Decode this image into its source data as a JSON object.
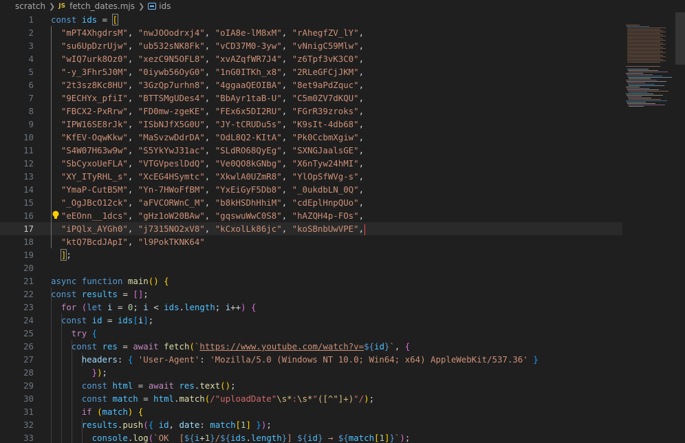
{
  "breadcrumb": {
    "folder": "scratch",
    "file_type": "JS",
    "file": "fetch_dates.mjs",
    "symbol": "ids"
  },
  "editor": {
    "active_line": 17,
    "lines": [
      {
        "n": "1",
        "t": [
          [
            "k",
            "const "
          ],
          [
            "v",
            "ids"
          ],
          [
            "o",
            " = "
          ],
          [
            "b1",
            "["
          ]
        ]
      },
      {
        "n": "2",
        "t": [
          [
            "s",
            "\"mPT4XhgdrsM\""
          ],
          [
            "o",
            ", "
          ],
          [
            "s",
            "\"nwJOOodrxj4\""
          ],
          [
            "o",
            ", "
          ],
          [
            "s",
            "\"oIA8e-lM8xM\""
          ],
          [
            "o",
            ", "
          ],
          [
            "s",
            "\"rAhegfZV_lY\""
          ],
          [
            "o",
            ","
          ]
        ]
      },
      {
        "n": "3",
        "t": [
          [
            "s",
            "\"su6UpDzrUjw\""
          ],
          [
            "o",
            ", "
          ],
          [
            "s",
            "\"ub532sNK8Fk\""
          ],
          [
            "o",
            ", "
          ],
          [
            "s",
            "\"vCD37M0-3yw\""
          ],
          [
            "o",
            ", "
          ],
          [
            "s",
            "\"vNnigC59Mlw\""
          ],
          [
            "o",
            ","
          ]
        ]
      },
      {
        "n": "4",
        "t": [
          [
            "s",
            "\"wIQ7urk8Oz0\""
          ],
          [
            "o",
            ", "
          ],
          [
            "s",
            "\"xezC9N5OFL8\""
          ],
          [
            "o",
            ", "
          ],
          [
            "s",
            "\"xvAZqfWR7J4\""
          ],
          [
            "o",
            ", "
          ],
          [
            "s",
            "\"z6Tpf3vK3C0\""
          ],
          [
            "o",
            ","
          ]
        ]
      },
      {
        "n": "5",
        "t": [
          [
            "s",
            "\"-y_3Fhr5J0M\""
          ],
          [
            "o",
            ", "
          ],
          [
            "s",
            "\"0iywb56OyG0\""
          ],
          [
            "o",
            ", "
          ],
          [
            "s",
            "\"1nG0ITKh_x8\""
          ],
          [
            "o",
            ", "
          ],
          [
            "s",
            "\"2RLeGFCjJKM\""
          ],
          [
            "o",
            ","
          ]
        ]
      },
      {
        "n": "6",
        "t": [
          [
            "s",
            "\"2t3sz8Kc8HU\""
          ],
          [
            "o",
            ", "
          ],
          [
            "s",
            "\"3GzQp7urhn8\""
          ],
          [
            "o",
            ", "
          ],
          [
            "s",
            "\"4ggaaQEOIBA\""
          ],
          [
            "o",
            ", "
          ],
          [
            "s",
            "\"8et9aPdZquc\""
          ],
          [
            "o",
            ","
          ]
        ]
      },
      {
        "n": "7",
        "t": [
          [
            "s",
            "\"9ECHYx_pfiI\""
          ],
          [
            "o",
            ", "
          ],
          [
            "s",
            "\"BTTSMgUDes4\""
          ],
          [
            "o",
            ", "
          ],
          [
            "s",
            "\"BbAyr1taB-U\""
          ],
          [
            "o",
            ", "
          ],
          [
            "s",
            "\"C5m0ZV7dKQU\""
          ],
          [
            "o",
            ","
          ]
        ]
      },
      {
        "n": "8",
        "t": [
          [
            "s",
            "\"FBCX2-PxRrw\""
          ],
          [
            "o",
            ", "
          ],
          [
            "s",
            "\"FD0mw-zgeKE\""
          ],
          [
            "o",
            ", "
          ],
          [
            "s",
            "\"FEx6x5DI2RU\""
          ],
          [
            "o",
            ", "
          ],
          [
            "s",
            "\"FGrR39zroks\""
          ],
          [
            "o",
            ","
          ]
        ]
      },
      {
        "n": "9",
        "t": [
          [
            "s",
            "\"IPW16SE8rJk\""
          ],
          [
            "o",
            ", "
          ],
          [
            "s",
            "\"ISbNJfX5G0U\""
          ],
          [
            "o",
            ", "
          ],
          [
            "s",
            "\"JY-tCRUDu5s\""
          ],
          [
            "o",
            ", "
          ],
          [
            "s",
            "\"K9sIt-4db68\""
          ],
          [
            "o",
            ","
          ]
        ]
      },
      {
        "n": "10",
        "t": [
          [
            "s",
            "\"KfEV-OqwKkw\""
          ],
          [
            "o",
            ", "
          ],
          [
            "s",
            "\"MaSvzwDdrDA\""
          ],
          [
            "o",
            ", "
          ],
          [
            "s",
            "\"OdL8Q2-KItA\""
          ],
          [
            "o",
            ", "
          ],
          [
            "s",
            "\"Pk0CcbmXgiw\""
          ],
          [
            "o",
            ","
          ]
        ]
      },
      {
        "n": "11",
        "t": [
          [
            "s",
            "\"S4W07H63w9w\""
          ],
          [
            "o",
            ", "
          ],
          [
            "s",
            "\"S5YkYwJ31ac\""
          ],
          [
            "o",
            ", "
          ],
          [
            "s",
            "\"SLdRO68QyEg\""
          ],
          [
            "o",
            ", "
          ],
          [
            "s",
            "\"SXNGJaalsGE\""
          ],
          [
            "o",
            ","
          ]
        ]
      },
      {
        "n": "12",
        "t": [
          [
            "s",
            "\"SbCyxoUeFLA\""
          ],
          [
            "o",
            ", "
          ],
          [
            "s",
            "\"VTGVpeslDdQ\""
          ],
          [
            "o",
            ", "
          ],
          [
            "s",
            "\"Ve0QO8kGNbg\""
          ],
          [
            "o",
            ", "
          ],
          [
            "s",
            "\"X6nTyw24hMI\""
          ],
          [
            "o",
            ","
          ]
        ]
      },
      {
        "n": "13",
        "t": [
          [
            "s",
            "\"XY_ITyRHL_s\""
          ],
          [
            "o",
            ", "
          ],
          [
            "s",
            "\"XcEG4HSymtc\""
          ],
          [
            "o",
            ", "
          ],
          [
            "s",
            "\"XkwlA0UZmR8\""
          ],
          [
            "o",
            ", "
          ],
          [
            "s",
            "\"YlOpSfWVg-s\""
          ],
          [
            "o",
            ","
          ]
        ]
      },
      {
        "n": "14",
        "t": [
          [
            "s",
            "\"YmaP-CutB5M\""
          ],
          [
            "o",
            ", "
          ],
          [
            "s",
            "\"Yn-7HWoFfBM\""
          ],
          [
            "o",
            ", "
          ],
          [
            "s",
            "\"YxEiGyF5Db8\""
          ],
          [
            "o",
            ", "
          ],
          [
            "s",
            "\"_0ukdbLN_0Q\""
          ],
          [
            "o",
            ","
          ]
        ]
      },
      {
        "n": "15",
        "t": [
          [
            "s",
            "\"_OgJBcO12ck\""
          ],
          [
            "o",
            ", "
          ],
          [
            "s",
            "\"aFVCORWnC_M\""
          ],
          [
            "o",
            ", "
          ],
          [
            "s",
            "\"b8kHSDhHhiM\""
          ],
          [
            "o",
            ", "
          ],
          [
            "s",
            "\"cdEplHnpQUo\""
          ],
          [
            "o",
            ","
          ]
        ]
      },
      {
        "n": "16",
        "t": [
          [
            "s",
            "\"eEOnn__1dcs\""
          ],
          [
            "o",
            ", "
          ],
          [
            "s",
            "\"gHz1oW20BAw\""
          ],
          [
            "o",
            ", "
          ],
          [
            "s",
            "\"gqswuWwC0S8\""
          ],
          [
            "o",
            ", "
          ],
          [
            "s",
            "\"hAZQH4p-FOs\""
          ],
          [
            "o",
            ","
          ]
        ]
      },
      {
        "n": "17",
        "t": [
          [
            "s",
            "\"iPQlx_AYGh0\""
          ],
          [
            "o",
            ", "
          ],
          [
            "s",
            "\"j7315NO2xV8\""
          ],
          [
            "o",
            ", "
          ],
          [
            "s",
            "\"kCxolLk86jc\""
          ],
          [
            "o",
            ", "
          ],
          [
            "s",
            "\"koSBnbUwVPE\""
          ],
          [
            "o",
            ","
          ]
        ]
      },
      {
        "n": "18",
        "t": [
          [
            "s",
            "\"ktQ7BcdJApI\""
          ],
          [
            "o",
            ", "
          ],
          [
            "s",
            "\"l9PokTKNK64\""
          ]
        ]
      },
      {
        "n": "19",
        "t": [
          [
            "b1",
            "]"
          ],
          [
            "o",
            ";"
          ]
        ]
      },
      {
        "n": "20",
        "t": []
      },
      {
        "n": "21",
        "t": [
          [
            "k",
            "async "
          ],
          [
            "k",
            "function "
          ],
          [
            "f",
            "main"
          ],
          [
            "b1",
            "()"
          ],
          [
            "o",
            " "
          ],
          [
            "b1",
            "{"
          ]
        ]
      },
      {
        "n": "22",
        "t": [
          [
            "k",
            "const "
          ],
          [
            "v",
            "results"
          ],
          [
            "o",
            " = "
          ],
          [
            "b2",
            "[]"
          ],
          [
            "o",
            ";"
          ]
        ]
      },
      {
        "n": "23",
        "t": [
          [
            "kc",
            "for "
          ],
          [
            "b2",
            "("
          ],
          [
            "k",
            "let "
          ],
          [
            "p",
            "i"
          ],
          [
            "o",
            " = "
          ],
          [
            "n",
            "0"
          ],
          [
            "o",
            "; "
          ],
          [
            "p",
            "i"
          ],
          [
            "o",
            " < "
          ],
          [
            "v",
            "ids"
          ],
          [
            "o",
            "."
          ],
          [
            "v",
            "length"
          ],
          [
            "o",
            "; "
          ],
          [
            "p",
            "i"
          ],
          [
            "o",
            "++"
          ],
          [
            "b2",
            ")"
          ],
          [
            "o",
            " "
          ],
          [
            "b2",
            "{"
          ]
        ]
      },
      {
        "n": "24",
        "t": [
          [
            "k",
            "const "
          ],
          [
            "v",
            "id"
          ],
          [
            "o",
            " = "
          ],
          [
            "v",
            "ids"
          ],
          [
            "b3",
            "["
          ],
          [
            "p",
            "i"
          ],
          [
            "b3",
            "]"
          ],
          [
            "o",
            ";"
          ]
        ]
      },
      {
        "n": "25",
        "t": [
          [
            "kc",
            "try "
          ],
          [
            "b3",
            "{"
          ]
        ]
      },
      {
        "n": "26",
        "t": [
          [
            "k",
            "const "
          ],
          [
            "v",
            "res"
          ],
          [
            "o",
            " = "
          ],
          [
            "kc",
            "await "
          ],
          [
            "f",
            "fetch"
          ],
          [
            "b1",
            "("
          ],
          [
            "s",
            "`"
          ],
          [
            "url",
            "https://www.youtube.com/watch?v="
          ],
          [
            "k",
            "${"
          ],
          [
            "v",
            "id"
          ],
          [
            "k",
            "}"
          ],
          [
            "s",
            "`"
          ],
          [
            "o",
            ", "
          ],
          [
            "b2",
            "{"
          ]
        ]
      },
      {
        "n": "27",
        "t": [
          [
            "p",
            "headers"
          ],
          [
            "o",
            ": "
          ],
          [
            "b3",
            "{"
          ],
          [
            "o",
            " "
          ],
          [
            "s",
            "'User-Agent'"
          ],
          [
            "o",
            ": "
          ],
          [
            "s",
            "'Mozilla/5.0 (Windows NT 10.0; Win64; x64) AppleWebKit/537.36'"
          ],
          [
            "o",
            " "
          ],
          [
            "b3",
            "}"
          ]
        ]
      },
      {
        "n": "28",
        "t": [
          [
            "b2",
            "}"
          ],
          [
            "b1",
            ")"
          ],
          [
            "o",
            ";"
          ]
        ]
      },
      {
        "n": "29",
        "t": [
          [
            "k",
            "const "
          ],
          [
            "v",
            "html"
          ],
          [
            "o",
            " = "
          ],
          [
            "kc",
            "await "
          ],
          [
            "v",
            "res"
          ],
          [
            "o",
            "."
          ],
          [
            "f",
            "text"
          ],
          [
            "b1",
            "()"
          ],
          [
            "o",
            ";"
          ]
        ]
      },
      {
        "n": "30",
        "t": [
          [
            "k",
            "const "
          ],
          [
            "v",
            "match"
          ],
          [
            "o",
            " = "
          ],
          [
            "v",
            "html"
          ],
          [
            "o",
            "."
          ],
          [
            "f",
            "match"
          ],
          [
            "b1",
            "("
          ],
          [
            "re",
            "/\"uploadDate\""
          ],
          [
            "rx",
            "\\s*"
          ],
          [
            "re",
            ":"
          ],
          [
            "rx",
            "\\s*"
          ],
          [
            "re",
            "\""
          ],
          [
            "rx",
            "([^\"]+)"
          ],
          [
            "re",
            "\"/"
          ],
          [
            "b1",
            ")"
          ],
          [
            "o",
            ";"
          ]
        ]
      },
      {
        "n": "31",
        "t": [
          [
            "kc",
            "if "
          ],
          [
            "b1",
            "("
          ],
          [
            "v",
            "match"
          ],
          [
            "b1",
            ")"
          ],
          [
            "o",
            " "
          ],
          [
            "b1",
            "{"
          ]
        ]
      },
      {
        "n": "32",
        "t": [
          [
            "v",
            "results"
          ],
          [
            "o",
            "."
          ],
          [
            "f",
            "push"
          ],
          [
            "b2",
            "("
          ],
          [
            "b3",
            "{"
          ],
          [
            "o",
            " "
          ],
          [
            "v",
            "id"
          ],
          [
            "o",
            ", "
          ],
          [
            "p",
            "date"
          ],
          [
            "o",
            ": "
          ],
          [
            "v",
            "match"
          ],
          [
            "b1",
            "["
          ],
          [
            "n",
            "1"
          ],
          [
            "b1",
            "]"
          ],
          [
            "o",
            " "
          ],
          [
            "b3",
            "}"
          ],
          [
            "b2",
            ")"
          ],
          [
            "o",
            ";"
          ]
        ]
      },
      {
        "n": "33",
        "t": [
          [
            "v",
            "console"
          ],
          [
            "o",
            "."
          ],
          [
            "f",
            "log"
          ],
          [
            "b2",
            "("
          ],
          [
            "s",
            "`OK  ["
          ],
          [
            "k",
            "${"
          ],
          [
            "v",
            "i"
          ],
          [
            "o",
            "+"
          ],
          [
            "n",
            "1"
          ],
          [
            "k",
            "}"
          ],
          [
            "s",
            "/"
          ],
          [
            "k",
            "${"
          ],
          [
            "v",
            "ids"
          ],
          [
            "o",
            "."
          ],
          [
            "v",
            "length"
          ],
          [
            "k",
            "}"
          ],
          [
            "s",
            "] "
          ],
          [
            "k",
            "${"
          ],
          [
            "v",
            "id"
          ],
          [
            "k",
            "}"
          ],
          [
            "s",
            " → "
          ],
          [
            "k",
            "${"
          ],
          [
            "v",
            "match"
          ],
          [
            "b1",
            "["
          ],
          [
            "n",
            "1"
          ],
          [
            "b1",
            "]"
          ],
          [
            "k",
            "}"
          ],
          [
            "s",
            "`"
          ],
          [
            "b2",
            ")"
          ],
          [
            "o",
            ";"
          ]
        ]
      }
    ]
  }
}
